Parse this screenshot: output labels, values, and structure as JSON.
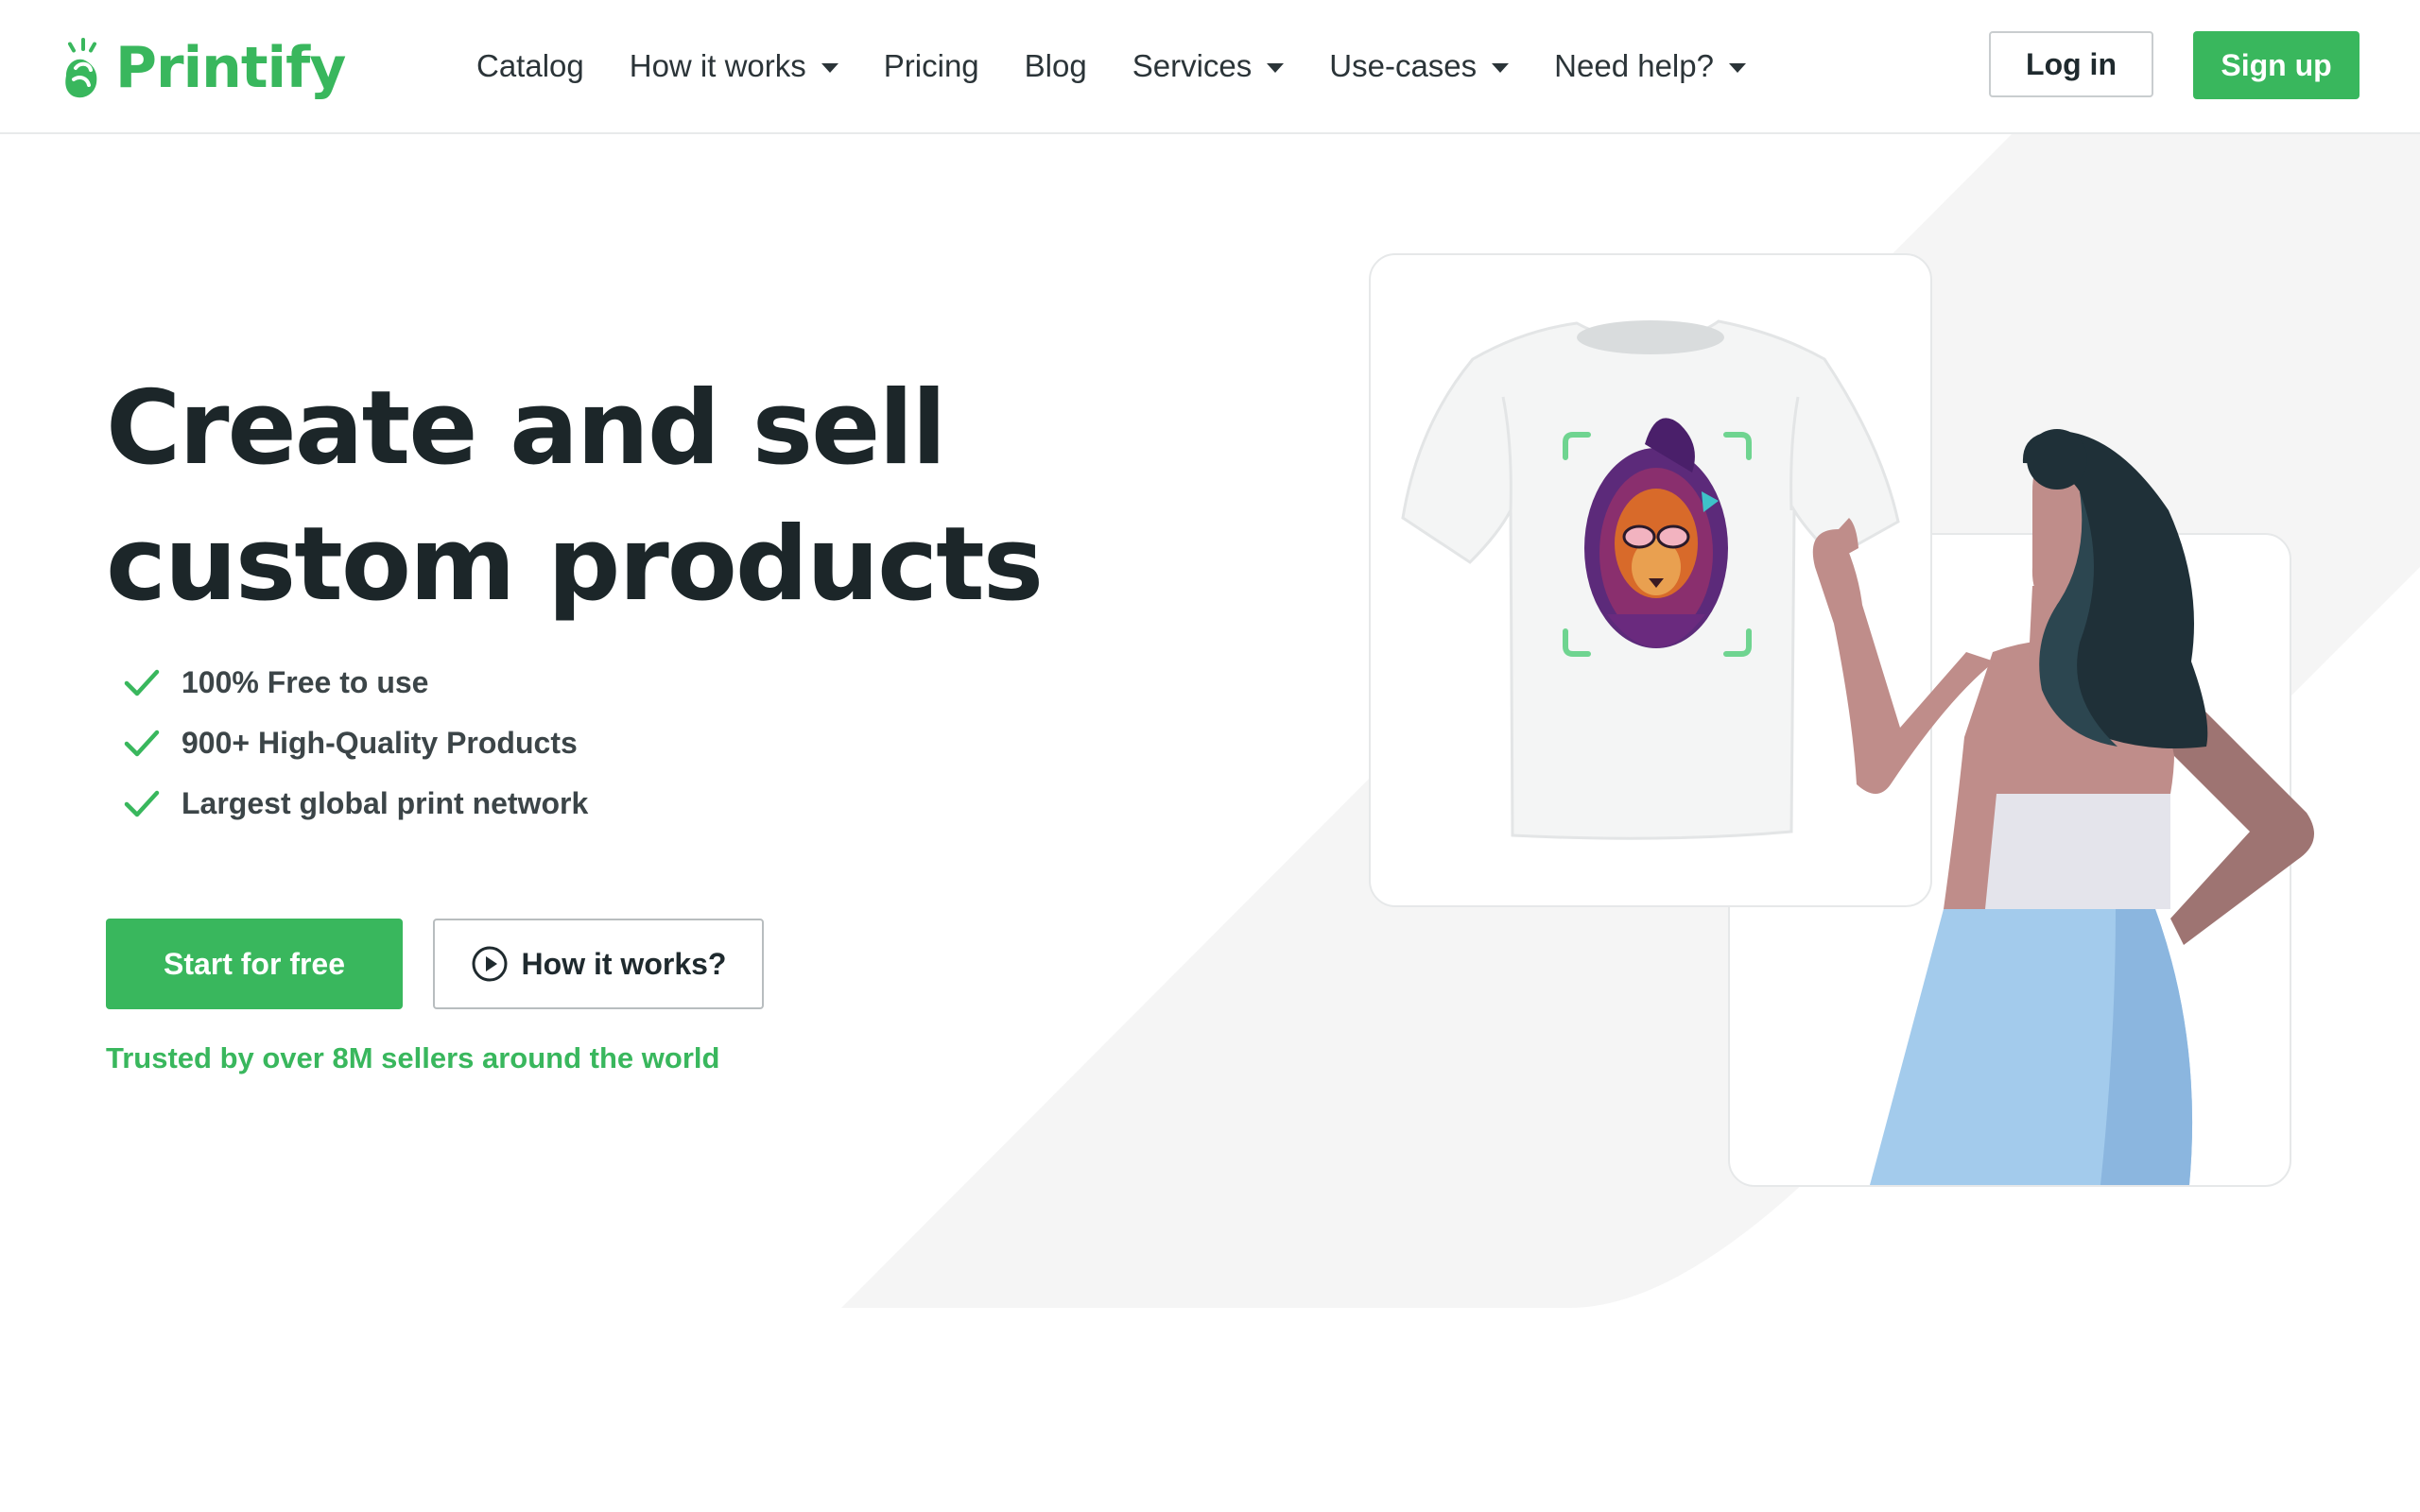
{
  "brand": {
    "name": "Printify",
    "color": "#39b75d"
  },
  "nav": {
    "items": [
      {
        "label": "Catalog",
        "dropdown": false
      },
      {
        "label": "How it works",
        "dropdown": true
      },
      {
        "label": "Pricing",
        "dropdown": false
      },
      {
        "label": "Blog",
        "dropdown": false
      },
      {
        "label": "Services",
        "dropdown": true
      },
      {
        "label": "Use-cases",
        "dropdown": true
      },
      {
        "label": "Need help?",
        "dropdown": true
      }
    ],
    "login_label": "Log in",
    "signup_label": "Sign up"
  },
  "hero": {
    "headline_line1": "Create and sell",
    "headline_line2": "custom products",
    "features": [
      "100% Free to use",
      "900+ High-Quality Products",
      "Largest global print network"
    ],
    "start_label": "Start for free",
    "how_label": "How it works?",
    "trusted_text": "Trusted by over 8M sellers around the world"
  },
  "icons": {
    "check": "check-icon",
    "play": "play-circle-icon",
    "caret": "chevron-down-icon"
  },
  "colors": {
    "accent": "#39b75d",
    "text_dark": "#1c2629",
    "background_shape": "#f5f5f5"
  }
}
